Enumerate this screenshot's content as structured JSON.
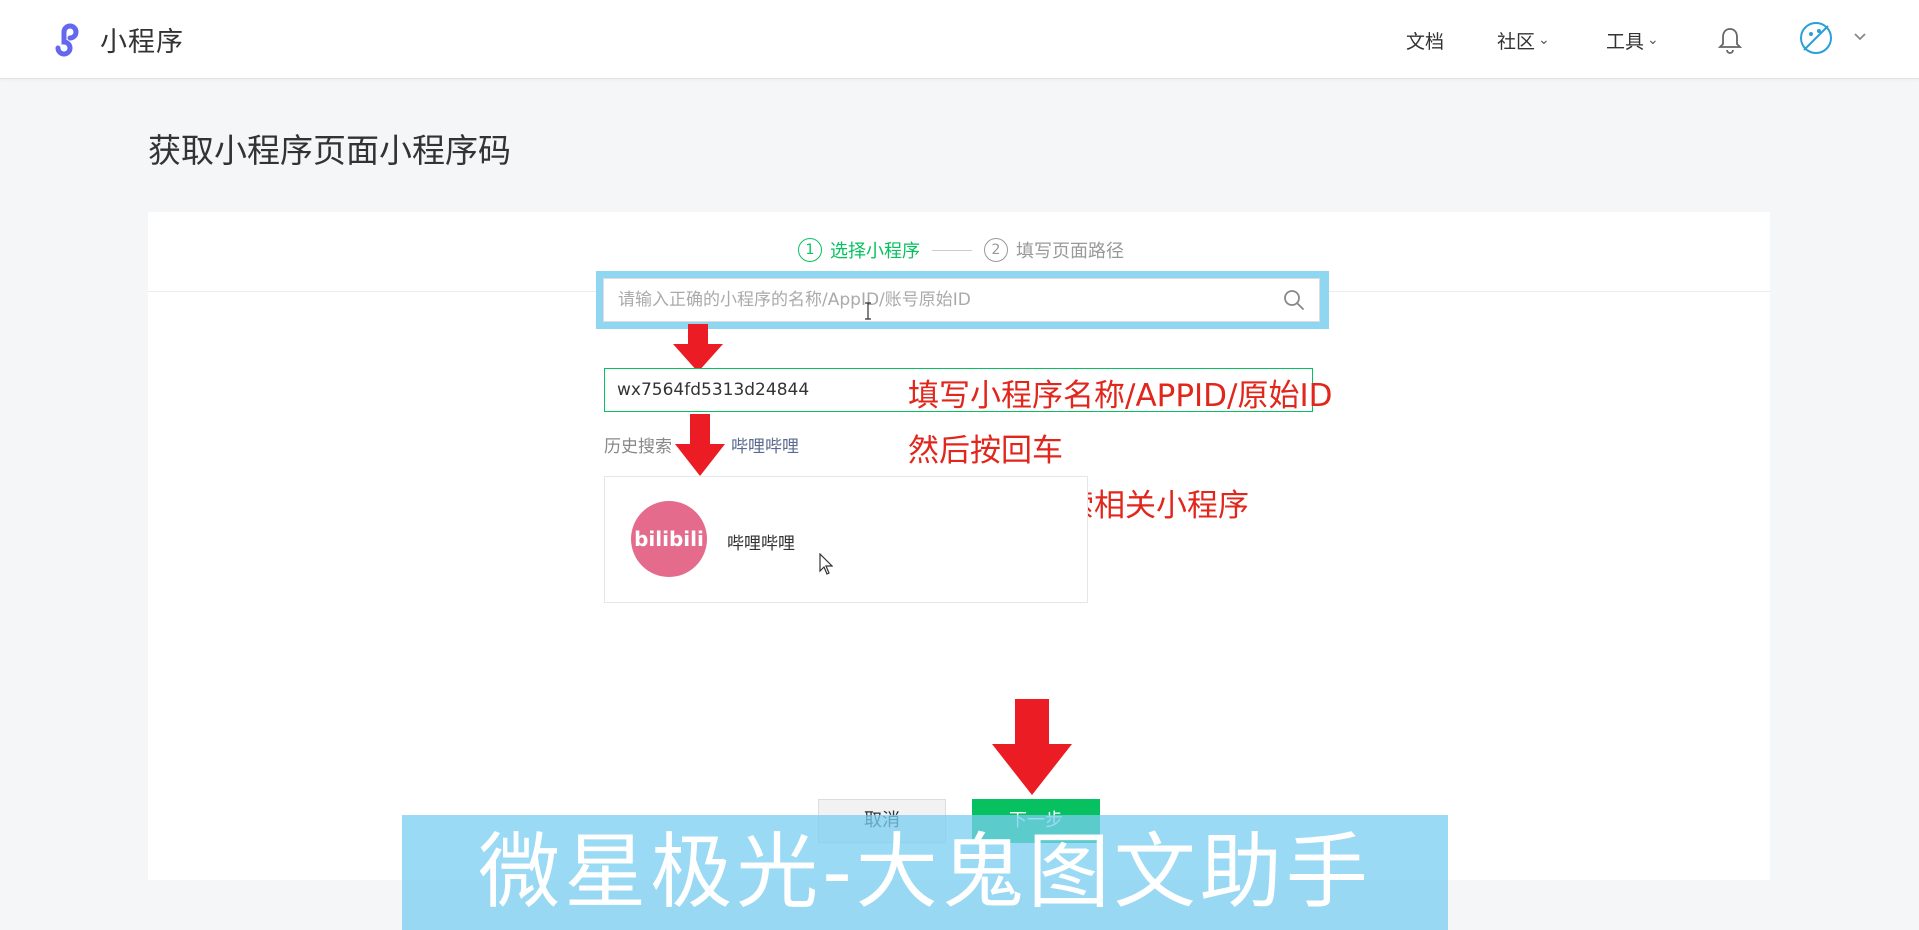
{
  "app": {
    "name": "小程序",
    "brand_color": "#6467f0"
  },
  "nav": {
    "docs": "文档",
    "community": "社区",
    "tools": "工具"
  },
  "page": {
    "title": "获取小程序页面小程序码"
  },
  "steps": [
    {
      "num": "1",
      "label": "选择小程序",
      "active": true
    },
    {
      "num": "2",
      "label": "填写页面路径",
      "active": false
    }
  ],
  "search": {
    "placeholder": "请输入正确的小程序的名称/AppID/账号原始ID",
    "value": "wx7564fd5313d24844"
  },
  "history": {
    "label": "历史搜索",
    "item": "哔哩哔哩"
  },
  "result": {
    "logo_text": "bilibili",
    "name": "哔哩哔哩"
  },
  "annotations": [
    "填写小程序名称/APPID/原始ID",
    "然后按回车",
    "可以直接搜索相关小程序"
  ],
  "buttons": {
    "cancel": "取消",
    "next": "下一步"
  },
  "watermark": "微星极光-大鬼图文助手",
  "colors": {
    "accent": "#07c160",
    "annotation": "#e1261c",
    "arrow": "#ec1c24",
    "highlight": "#8fd7f0"
  }
}
